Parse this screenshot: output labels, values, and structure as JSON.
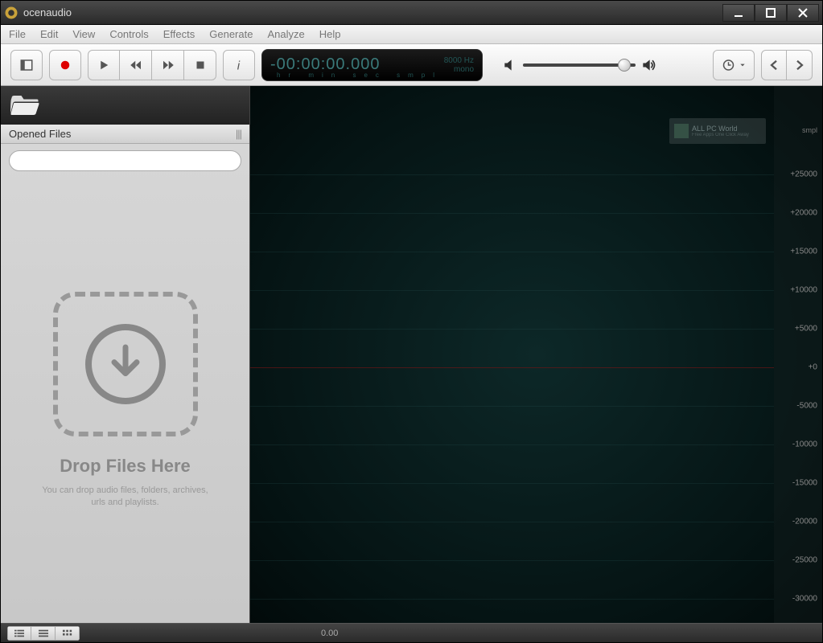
{
  "title": "ocenaudio",
  "menu": {
    "file": "File",
    "edit": "Edit",
    "view": "View",
    "controls": "Controls",
    "effects": "Effects",
    "generate": "Generate",
    "analyze": "Analyze",
    "help": "Help"
  },
  "time_display": {
    "main": "-00:00:00.000",
    "labels": "hr  min sec   smpl",
    "rate": "8000 Hz",
    "channels": "mono"
  },
  "sidebar": {
    "opened_files": "Opened Files",
    "search_placeholder": "",
    "drop_title": "Drop Files Here",
    "drop_sub": "You can drop audio files, folders, archives, urls and playlists."
  },
  "yaxis": {
    "unit": "smpl",
    "ticks": [
      "+25000",
      "+20000",
      "+15000",
      "+10000",
      "+5000",
      "+0",
      "-5000",
      "-10000",
      "-15000",
      "-20000",
      "-25000",
      "-30000"
    ]
  },
  "status": {
    "xstart": "0.00"
  },
  "watermark": {
    "text": "ALL PC World",
    "subtext": "Free Apps One Click Away"
  }
}
